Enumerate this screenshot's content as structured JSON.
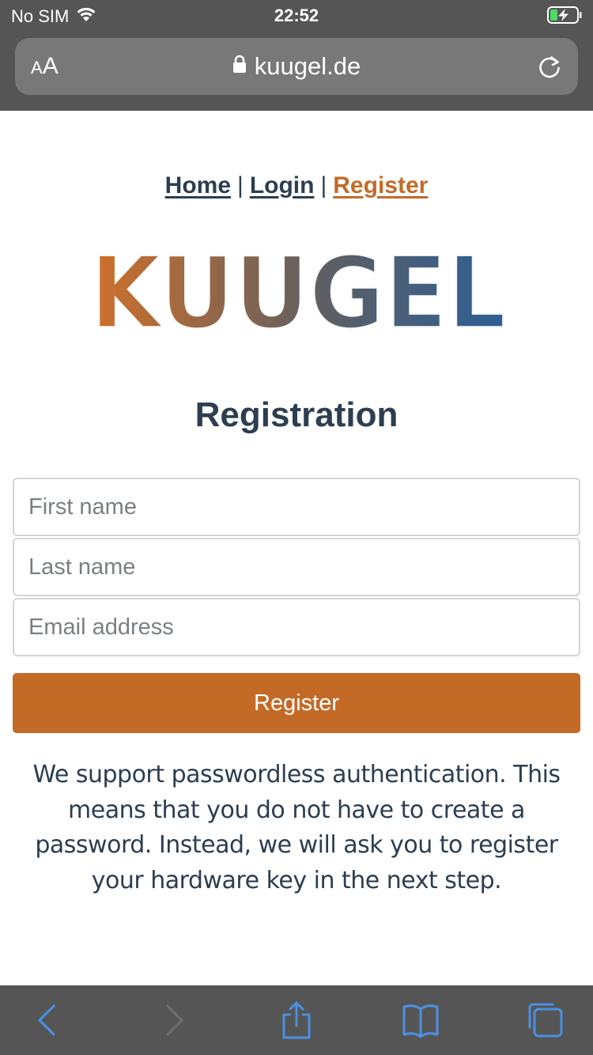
{
  "status_bar": {
    "carrier": "No SIM",
    "time": "22:52"
  },
  "browser": {
    "text_size_button": {
      "small": "A",
      "large": "A"
    },
    "url": "kuugel.de"
  },
  "nav": {
    "home": "Home",
    "sep1": "|",
    "login": "Login",
    "sep2": "|",
    "register": "Register"
  },
  "logo": {
    "text": "KUUGEL",
    "gradient": [
      "#d0702a",
      "#5f5f62",
      "#2d5f96"
    ]
  },
  "page_title": "Registration",
  "form": {
    "first_name_placeholder": "First name",
    "last_name_placeholder": "Last name",
    "email_placeholder": "Email address",
    "submit_label": "Register"
  },
  "info_text": "We support passwordless authentication. This means that you do not have to create a password. Instead, we will ask you to register your hardware key in the next step.",
  "toolbar": {
    "icons": [
      "back-icon",
      "forward-icon",
      "share-icon",
      "bookmarks-icon",
      "tabs-icon"
    ]
  },
  "colors": {
    "accent": "#c46a27",
    "text_dark": "#2c3e50",
    "chrome": "#555555",
    "toolbar_icon_active": "#4a90e2",
    "toolbar_icon_disabled": "#6e6e6e"
  }
}
